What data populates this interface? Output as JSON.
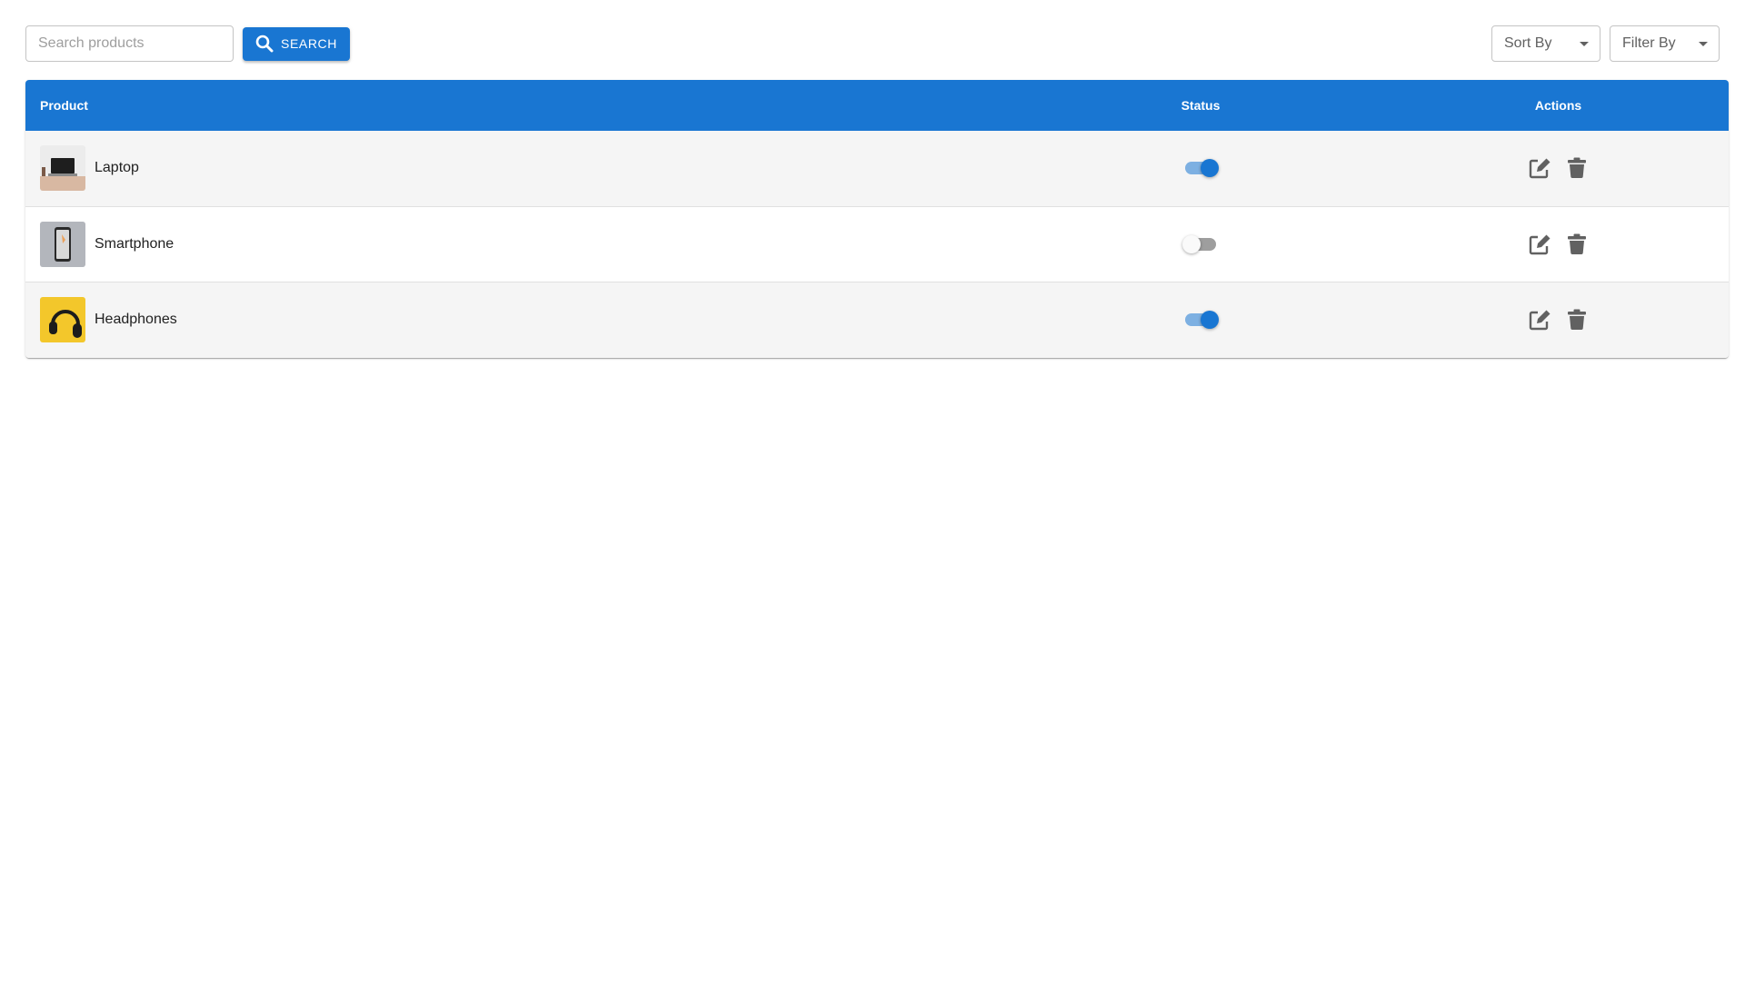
{
  "toolbar": {
    "search": {
      "placeholder": "Search products",
      "value": ""
    },
    "search_button_label": "SEARCH",
    "sort_select": {
      "label": "Sort By"
    },
    "filter_select": {
      "label": "Filter By"
    }
  },
  "table": {
    "columns": [
      "Product",
      "Status",
      "Actions"
    ],
    "rows": [
      {
        "name": "Laptop",
        "status_on": true
      },
      {
        "name": "Smartphone",
        "status_on": false
      },
      {
        "name": "Headphones",
        "status_on": true
      }
    ]
  },
  "colors": {
    "accent": "#1976d2",
    "header_text": "#ffffff",
    "row_alt": "#f5f5f5",
    "icon": "#616161"
  },
  "icons": {
    "search": "search-icon",
    "edit": "edit-icon",
    "delete": "trash-icon",
    "dropdown": "caret-down-icon"
  }
}
